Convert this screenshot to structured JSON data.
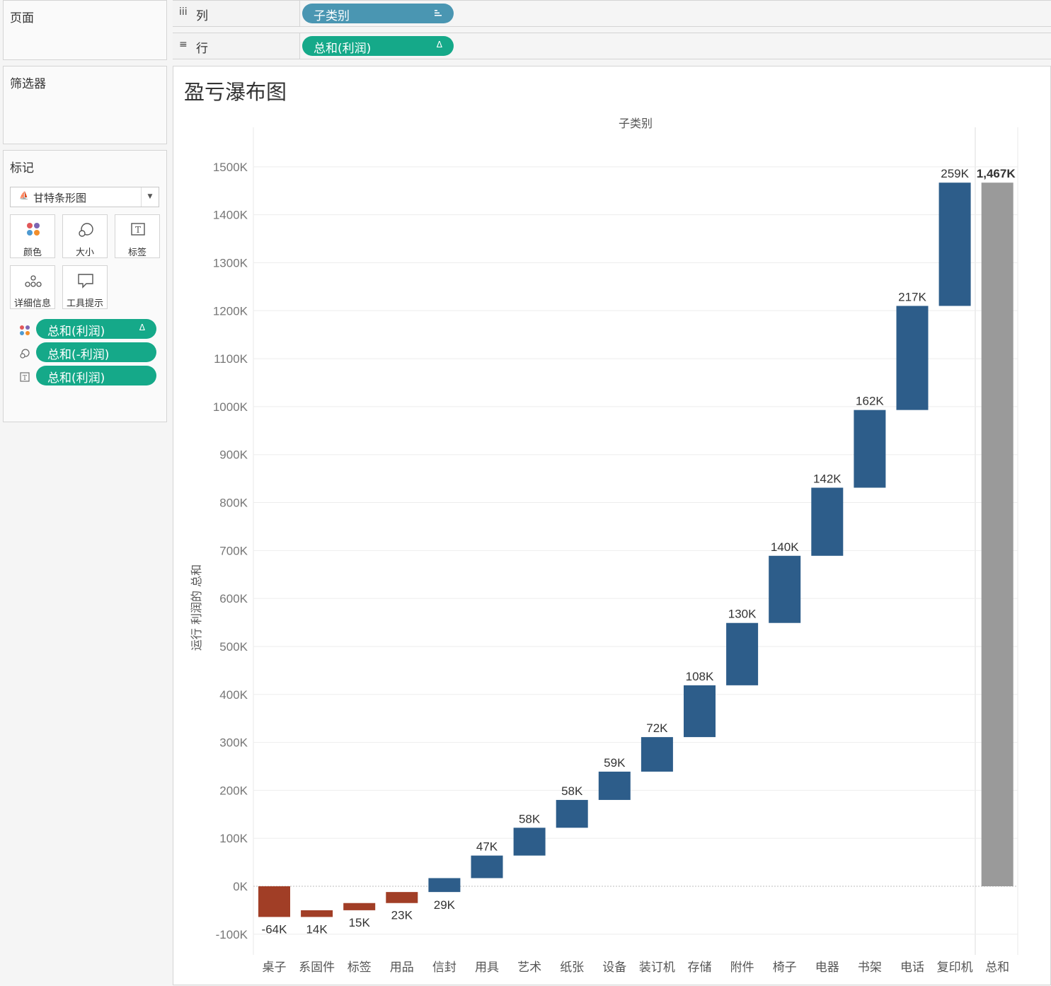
{
  "sidebar": {
    "pages_title": "页面",
    "filters_title": "筛选器",
    "marks": {
      "title": "标记",
      "mark_type": "甘特条形图",
      "buttons": [
        {
          "label": "颜色",
          "icon": "color-dots-icon"
        },
        {
          "label": "大小",
          "icon": "size-icon"
        },
        {
          "label": "标签",
          "icon": "label-text-icon"
        },
        {
          "label": "详细信息",
          "icon": "detail-dots-icon"
        },
        {
          "label": "工具提示",
          "icon": "tooltip-bubble-icon"
        }
      ],
      "pills": [
        {
          "label": "总和(利润)",
          "encoding": "color",
          "delta": "Δ"
        },
        {
          "label": "总和(-利润)",
          "encoding": "size"
        },
        {
          "label": "总和(利润)",
          "encoding": "label"
        }
      ]
    }
  },
  "shelves": {
    "columns": {
      "label": "列",
      "pill": "子类别",
      "icon": "iii"
    },
    "rows": {
      "label": "行",
      "pill": "总和(利润)",
      "icon": "≡",
      "delta": "Δ"
    }
  },
  "colors": {
    "positive": "#2d5d8a",
    "negative": "#a13e26",
    "total": "#9a9a9a",
    "pill_green": "#15a989",
    "pill_blue": "#4a96b2"
  },
  "chart_data": {
    "type": "bar",
    "subtype": "waterfall",
    "title": "盈亏瀑布图",
    "xlabel": "子类别",
    "ylabel": "运行 利润的 总和",
    "ylim": [
      -140,
      1550
    ],
    "y_ticks": [
      -100,
      0,
      100,
      200,
      300,
      400,
      500,
      600,
      700,
      800,
      900,
      1000,
      1100,
      1200,
      1300,
      1400,
      1500
    ],
    "y_tick_labels": [
      "-100K",
      "0K",
      "100K",
      "200K",
      "300K",
      "400K",
      "500K",
      "600K",
      "700K",
      "800K",
      "900K",
      "1000K",
      "1100K",
      "1200K",
      "1300K",
      "1400K",
      "1500K"
    ],
    "units": "K",
    "grid": true,
    "categories": [
      "桌子",
      "系固件",
      "标签",
      "用品",
      "信封",
      "用具",
      "艺术",
      "纸张",
      "设备",
      "装订机",
      "存储",
      "附件",
      "椅子",
      "电器",
      "书架",
      "电话",
      "复印机",
      "总和"
    ],
    "bars": [
      {
        "start": 0,
        "end": -64,
        "label": "-64K",
        "kind": "negative"
      },
      {
        "start": -50,
        "end": -64,
        "label": "14K",
        "kind": "negative"
      },
      {
        "start": -35,
        "end": -50,
        "label": "15K",
        "kind": "negative"
      },
      {
        "start": -12,
        "end": -35,
        "label": "23K",
        "kind": "negative"
      },
      {
        "start": -12,
        "end": 17,
        "label": "29K",
        "kind": "positive"
      },
      {
        "start": 17,
        "end": 64,
        "label": "47K",
        "kind": "positive"
      },
      {
        "start": 64,
        "end": 122,
        "label": "58K",
        "kind": "positive"
      },
      {
        "start": 122,
        "end": 180,
        "label": "58K",
        "kind": "positive"
      },
      {
        "start": 180,
        "end": 239,
        "label": "59K",
        "kind": "positive"
      },
      {
        "start": 239,
        "end": 311,
        "label": "72K",
        "kind": "positive"
      },
      {
        "start": 311,
        "end": 419,
        "label": "108K",
        "kind": "positive"
      },
      {
        "start": 419,
        "end": 549,
        "label": "130K",
        "kind": "positive"
      },
      {
        "start": 549,
        "end": 689,
        "label": "140K",
        "kind": "positive"
      },
      {
        "start": 689,
        "end": 831,
        "label": "142K",
        "kind": "positive"
      },
      {
        "start": 831,
        "end": 993,
        "label": "162K",
        "kind": "positive"
      },
      {
        "start": 993,
        "end": 1210,
        "label": "217K",
        "kind": "positive"
      },
      {
        "start": 1210,
        "end": 1467,
        "label": "259K",
        "kind": "positive"
      },
      {
        "start": 0,
        "end": 1467,
        "label": "1,467K",
        "kind": "total"
      }
    ]
  }
}
